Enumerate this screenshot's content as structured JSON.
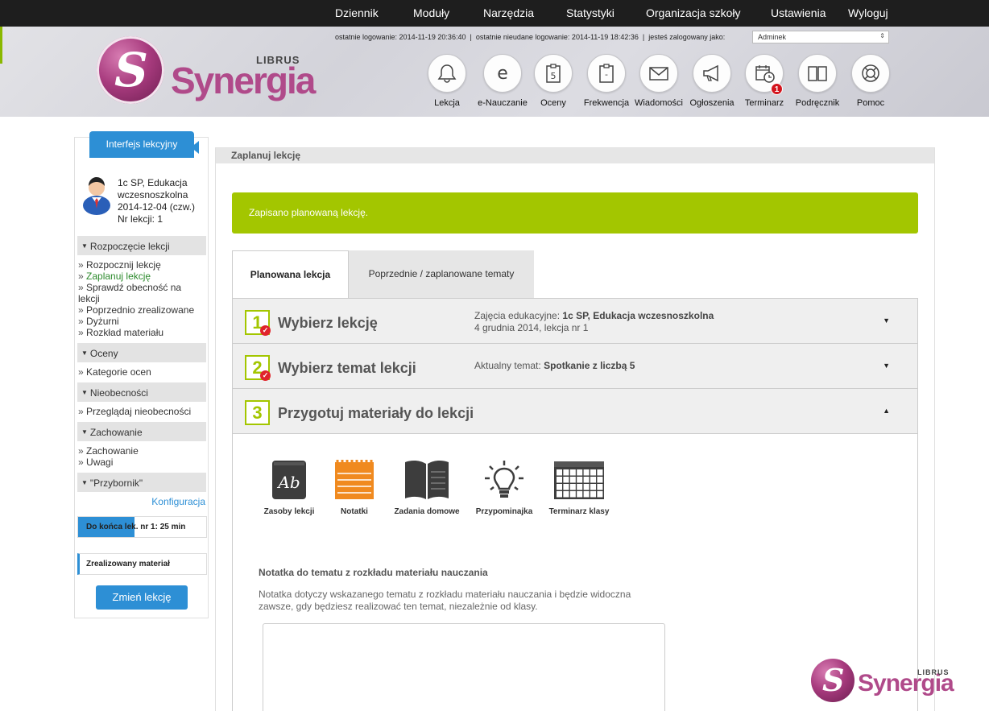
{
  "topnav": {
    "items": [
      "Dziennik",
      "Moduły",
      "Narzędzia",
      "Statystyki",
      "Organizacja szkoły",
      "Ustawienia",
      "Wyloguj"
    ]
  },
  "header": {
    "last_login_label": "ostatnie logowanie: 2014-11-19 20:36:40",
    "last_failed_label": "ostatnie nieudane logowanie: 2014-11-19 18:42:36",
    "logged_as_label": "jesteś zalogowany jako:",
    "separator": "|",
    "user_selected": "Adminek",
    "logo_word": "Synergia",
    "logo_brand": "LIBRUS",
    "logo_letter": "S"
  },
  "modules": [
    {
      "label": "Lekcja",
      "icon": "bell-icon"
    },
    {
      "label": "e-Nauczanie",
      "icon": "e-learning-icon",
      "glyph": "e"
    },
    {
      "label": "Oceny",
      "icon": "grades-clipboard-icon",
      "glyph": "5"
    },
    {
      "label": "Frekwencja",
      "icon": "attendance-clipboard-icon",
      "glyph": "-"
    },
    {
      "label": "Wiadomości",
      "icon": "envelope-icon"
    },
    {
      "label": "Ogłoszenia",
      "icon": "megaphone-icon"
    },
    {
      "label": "Terminarz",
      "icon": "calendar-clock-icon",
      "badge": "1"
    },
    {
      "label": "Podręcznik",
      "icon": "book-icon"
    },
    {
      "label": "Pomoc",
      "icon": "lifebuoy-icon"
    }
  ],
  "sidebar": {
    "tab_label": "Interfejs lekcyjny",
    "lesson_info": [
      "1c SP, Edukacja",
      "wczesnoszkolna",
      "2014-12-04 (czw.)",
      "Nr lekcji: 1"
    ],
    "sections": [
      {
        "title": "Rozpoczęcie lekcji",
        "links": [
          "Rozpocznij lekcję",
          "Zaplanuj lekcję",
          "Sprawdź obecność na lekcji",
          "Poprzednio zrealizowane",
          "Dyżurni",
          "Rozkład materiału"
        ]
      },
      {
        "title": "Oceny",
        "links": [
          "Kategorie ocen"
        ]
      },
      {
        "title": "Nieobecności",
        "links": [
          "Przeglądaj nieobecności"
        ]
      },
      {
        "title": "Zachowanie",
        "links": [
          "Zachowanie",
          "Uwagi"
        ]
      },
      {
        "title": "\"Przybornik\"",
        "links": []
      }
    ],
    "bullet": "»",
    "config_link": "Konfiguracja",
    "timer_text": "Do końca lek. nr 1: 25 min",
    "timer_progress": 0.44,
    "realized_label": "Zrealizowany materiał",
    "change_button": "Zmień lekcję"
  },
  "main": {
    "title": "Zaplanuj lekcję",
    "alert": "Zapisano planowaną lekcję.",
    "tabs": [
      "Planowana lekcja",
      "Poprzednie / zaplanowane tematy"
    ],
    "steps": [
      {
        "number": "1",
        "title": "Wybierz lekcję",
        "info_label": "Zajęcia edukacyjne:",
        "info_value": "1c SP, Edukacja wczesnoszkolna",
        "info_line2": "4 grudnia 2014, lekcja nr 1",
        "done": true,
        "chevron": "▼"
      },
      {
        "number": "2",
        "title": "Wybierz temat lekcji",
        "info_label": "Aktualny temat:",
        "info_value": "Spotkanie z liczbą 5",
        "info_line2": "",
        "done": true,
        "chevron": "▼"
      },
      {
        "number": "3",
        "title": "Przygotuj materiały do lekcji",
        "info_label": "",
        "info_value": "",
        "info_line2": "",
        "done": false,
        "chevron": "▲"
      }
    ],
    "tools": [
      {
        "label": "Zasoby lekcji",
        "icon": "resources-book-icon",
        "glyph": "Ab"
      },
      {
        "label": "Notatki",
        "icon": "notepad-icon"
      },
      {
        "label": "Zadania domowe",
        "icon": "open-book-icon"
      },
      {
        "label": "Przypominajka",
        "icon": "lightbulb-icon"
      },
      {
        "label": "Terminarz klasy",
        "icon": "class-calendar-icon"
      }
    ],
    "note_title": "Notatka do tematu z rozkładu materiału nauczania",
    "note_desc": "Notatka dotyczy wskazanego tematu z rozkładu materiału nauczania i będzie widoczna zawsze, gdy będziesz realizować ten temat, niezależnie od klasy.",
    "note_value": ""
  },
  "colors": {
    "accent_blue": "#2d8fd5",
    "success_green": "#a3c600",
    "brand_magenta": "#b04a8a",
    "badge_red": "#d3141d"
  }
}
